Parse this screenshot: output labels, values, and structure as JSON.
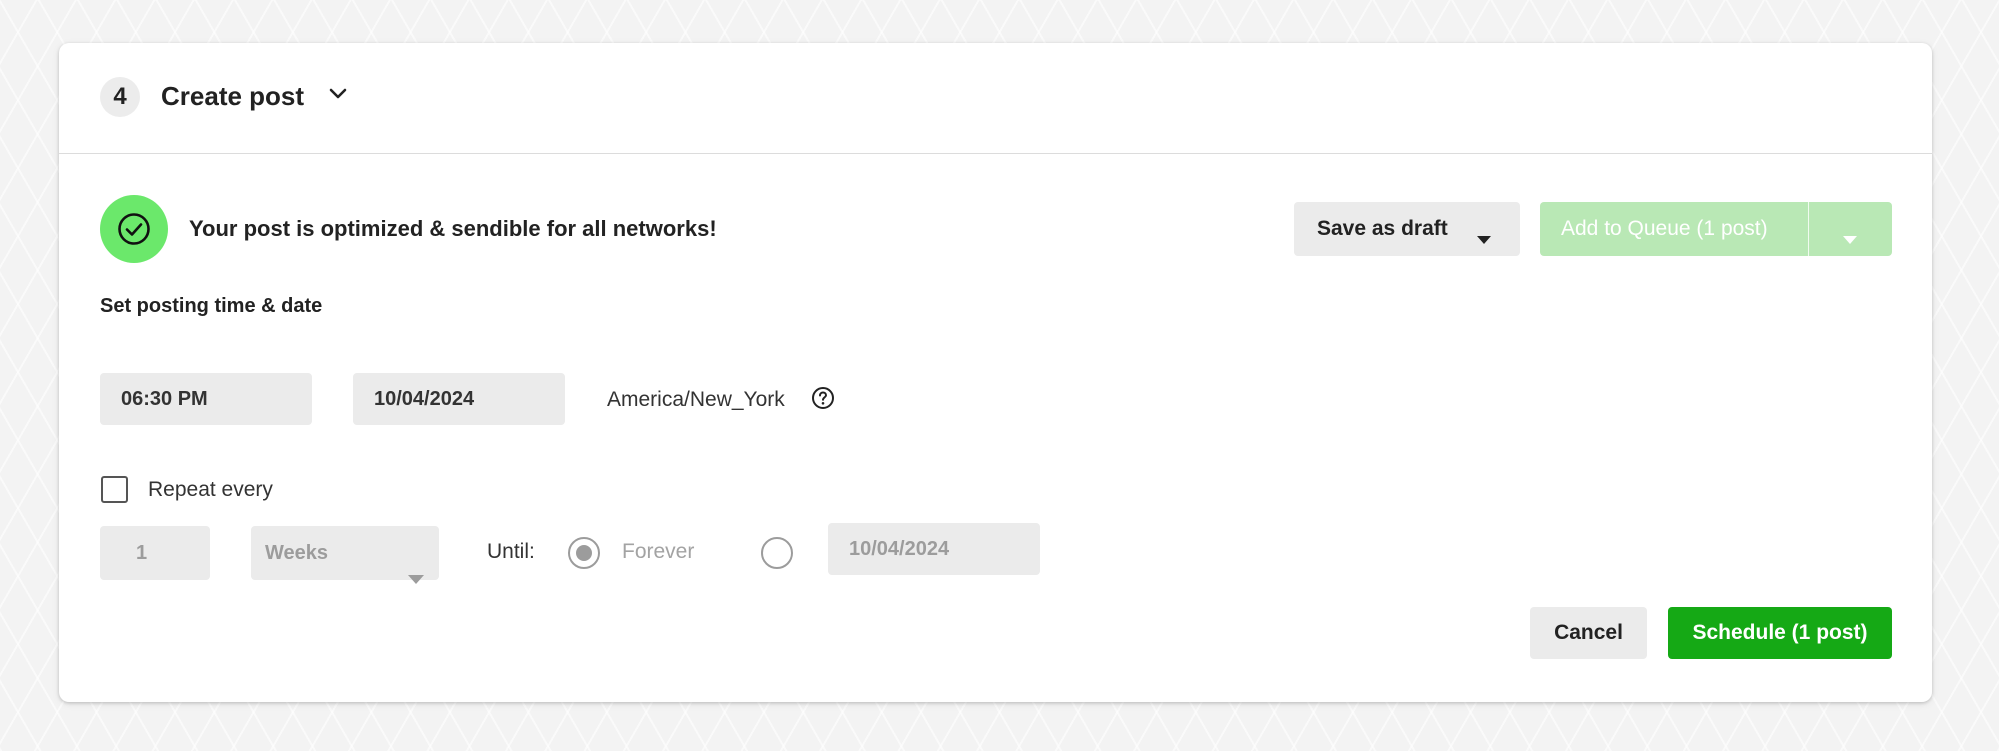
{
  "header": {
    "step_number": "4",
    "title": "Create post"
  },
  "status": {
    "message": "Your post is optimized & sendible for all networks!",
    "color": "#6be86b"
  },
  "actions": {
    "save_draft_label": "Save as draft",
    "add_queue_label": "Add to Queue (1 post)",
    "cancel_label": "Cancel",
    "schedule_label": "Schedule (1 post)",
    "schedule_color": "#15a915",
    "queue_color_disabled": "#b9e8b5"
  },
  "schedule": {
    "section_label": "Set posting time & date",
    "time": "06:30 PM",
    "date": "10/04/2024",
    "timezone": "America/New_York"
  },
  "repeat": {
    "checkbox_label": "Repeat every",
    "checked": false,
    "count": "1",
    "unit": "Weeks",
    "until_label": "Until:",
    "forever_label": "Forever",
    "forever_selected": true,
    "end_date": "10/04/2024"
  },
  "icons": {
    "step_chevron": "chevron-down-icon",
    "status": "check-circle-icon",
    "timezone_help": "question-circle-icon",
    "dropdown": "caret-down-icon"
  }
}
